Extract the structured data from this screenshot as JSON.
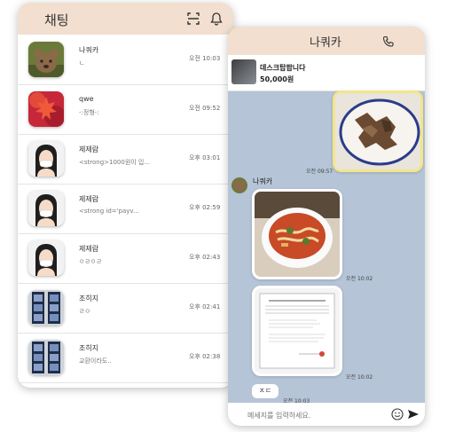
{
  "chat_list": {
    "title": "채팅",
    "icons": {
      "scan": "scan-icon",
      "notify": "bell-icon"
    },
    "items": [
      {
        "name": "나쿼카",
        "preview": "ㄴ",
        "time": "오전 10:03",
        "avatar": "quokka"
      },
      {
        "name": "qwe",
        "preview": "-:정형-:",
        "time": "오전 09:52",
        "avatar": "maple-leaf"
      },
      {
        "name": "제제람",
        "preview": "<strong>1000원이 입...",
        "time": "오후 03:01",
        "avatar": "girl-mask"
      },
      {
        "name": "제제람",
        "preview": "<strong id='payv...",
        "time": "오후 02:59",
        "avatar": "girl-mask"
      },
      {
        "name": "제제람",
        "preview": "ㅇㄹㅇㄹ",
        "time": "오후 02:43",
        "avatar": "girl-mask"
      },
      {
        "name": "조히지",
        "preview": "ㄹㅇ",
        "time": "오후 02:41",
        "avatar": "photo-booth"
      },
      {
        "name": "조히지",
        "preview": "교환이라도..",
        "time": "오후 02:38",
        "avatar": "photo-booth"
      }
    ]
  },
  "chat_room": {
    "title": "나쿼카",
    "product": {
      "name": "데스크탑팝니다",
      "price": "50,000원"
    },
    "messages": {
      "sent_image_time": "오전 09:57",
      "sender_name": "나쿼카",
      "received_image1_time": "오전 10:02",
      "received_image2_time": "오전 10:02",
      "text_message": "ㅈㄷ",
      "text_time": "오전 10:03"
    },
    "input_placeholder": "메세지를 입력하세요.",
    "colors": {
      "header": "#f2dfcf",
      "background": "#b5c4d6"
    }
  }
}
